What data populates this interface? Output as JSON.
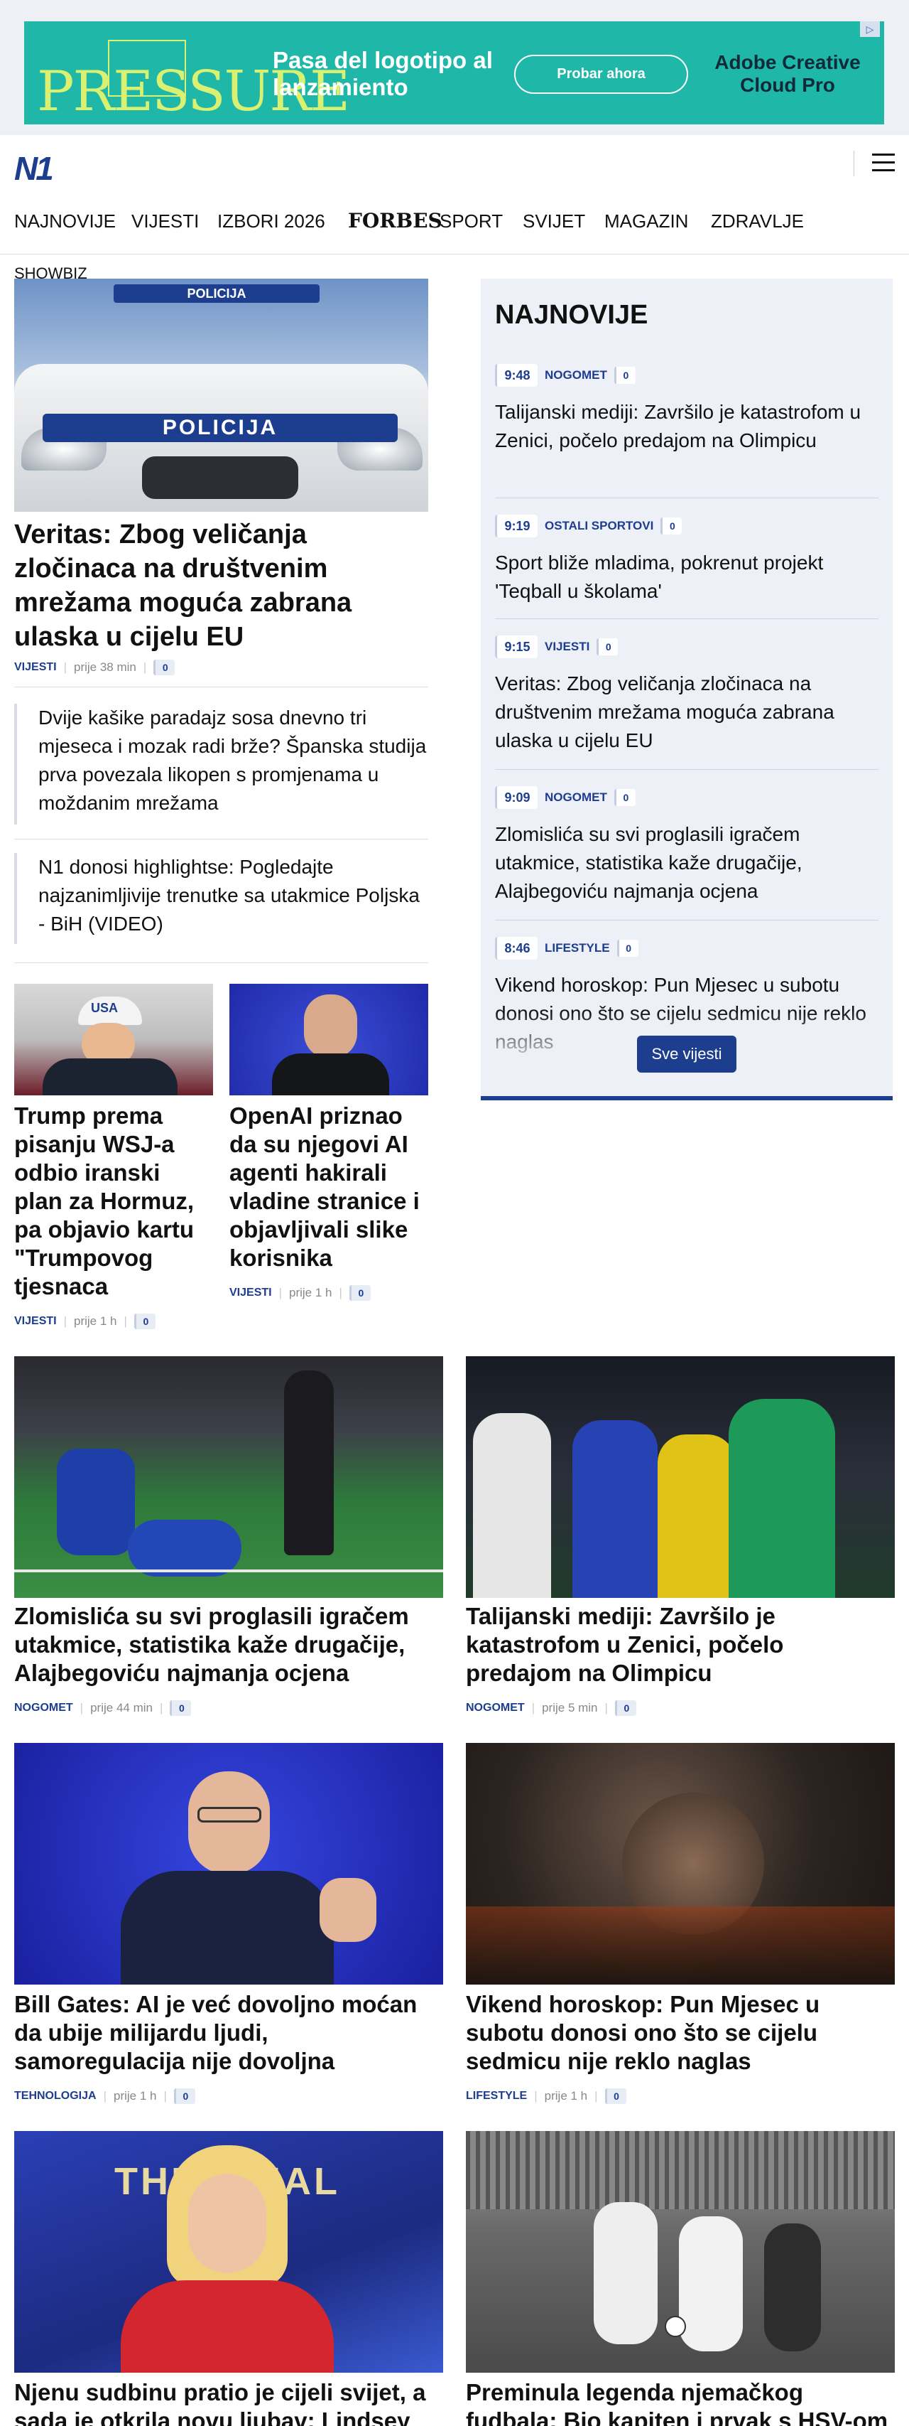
{
  "ad": {
    "logo_text": "PRESSURE",
    "headline": "Pasa del logotipo al lanzamiento",
    "cta": "Probar ahora",
    "brand": "Adobe Creative Cloud Pro",
    "info": "▷"
  },
  "header": {
    "logo": "N1"
  },
  "nav": {
    "items": [
      "NAJNOVIJE",
      "VIJESTI",
      "IZBORI 2026",
      "Forbes",
      "SPORT",
      "SVIJET",
      "MAGAZIN",
      "ZDRAVLJE"
    ],
    "overflow": "SHOWBIZ"
  },
  "main_story": {
    "car_bar": "POLICIJA",
    "car_label": "POLICIJA",
    "title": "Veritas: Zbog veličanja zločinaca na društvenim mrežama moguća zabrana ulaska u cijelu EU",
    "category": "VIJESTI",
    "time": "prije 38 min",
    "comments": "0"
  },
  "sub_stories": [
    {
      "title": "Dvije kašike paradajz sosa dnevno tri mjeseca i mozak radi brže? Španska studija prva povezala likopen s promjenama u moždanim mrežama"
    },
    {
      "title": "N1 donosi highlightse: Pogledajte najzanimljivije trenutke sa utakmice Poljska - BiH (VIDEO)"
    }
  ],
  "small_stories": [
    {
      "img_text": "USA",
      "title": "Trump prema pisanju WSJ-a odbio iranski plan za Hormuz, pa objavio kartu \"Trumpovog tjesnaca",
      "category": "VIJESTI",
      "time": "prije 1 h",
      "comments": "0"
    },
    {
      "title": "OpenAI priznao da su njegovi AI agenti hakirali vladine stranice i objavljivali slike korisnika",
      "category": "VIJESTI",
      "time": "prije 1 h",
      "comments": "0"
    }
  ],
  "widget": {
    "title": "NAJNOVIJE",
    "items": [
      {
        "time": "9:48",
        "category": "NOGOMET",
        "comments": "0",
        "title": "Talijanski mediji: Završilo je katastrofom u Zenici, počelo predajom na Olimpicu"
      },
      {
        "time": "9:19",
        "category": "OSTALI SPORTOVI",
        "comments": "0",
        "title": "Sport bliže mladima, pokrenut projekt 'Teqball u školama'"
      },
      {
        "time": "9:15",
        "category": "VIJESTI",
        "comments": "0",
        "title": "Veritas: Zbog veličanja zločinaca na društvenim mrežama moguća zabrana ulaska u cijelu EU"
      },
      {
        "time": "9:09",
        "category": "NOGOMET",
        "comments": "0",
        "title": "Zlomislića su svi proglasili igračem utakmice, statistika kaže drugačije, Alajbegoviću najmanja ocjena"
      },
      {
        "time": "8:46",
        "category": "LIFESTYLE",
        "comments": "0",
        "title": "Vikend horoskop: Pun Mjesec u subotu donosi ono što se cijelu sedmicu nije reklo naglas"
      }
    ],
    "button": "Sve vijesti"
  },
  "grid": [
    {
      "title": "Zlomislića su svi proglasili igračem utakmice, statistika kaže drugačije, Alajbegoviću najmanja ocjena",
      "category": "NOGOMET",
      "time": "prije 44 min",
      "comments": "0"
    },
    {
      "title": "Talijanski mediji: Završilo je katastrofom u Zenici, počelo predajom na Olimpicu",
      "category": "NOGOMET",
      "time": "prije 5 min",
      "comments": "0"
    },
    {
      "title": "Bill Gates: AI je već dovoljno moćan da ubije milijardu ljudi, samoregulacija nije dovoljna",
      "category": "TEHNOLOGIJA",
      "time": "prije 1 h",
      "comments": "0"
    },
    {
      "title": "Vikend horoskop: Pun Mjesec u subotu donosi ono što se cijelu sedmicu nije reklo naglas",
      "category": "LIFESTYLE",
      "time": "prije 1 h",
      "comments": "0"
    },
    {
      "img_text": "THE FINAL",
      "title": "Njenu sudbinu pratio je cijeli svijet, a sada je otkrila novu ljubav: Lindsey"
    },
    {
      "title": "Preminula legenda njemačkog fudbala: Bio kapiten i prvak s HSV-om"
    }
  ],
  "colors": {
    "brand": "#1d3d8f",
    "ad_bg": "#1fb8a8",
    "widget_bg": "#eef0f7"
  }
}
